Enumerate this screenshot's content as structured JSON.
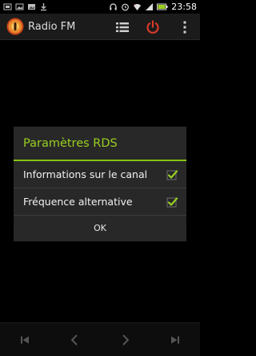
{
  "status_bar": {
    "time": "23:58",
    "left_icons": [
      "usb-icon",
      "image-icon",
      "image-icon",
      "download-icon"
    ],
    "right_icons": [
      "headset-icon",
      "alarm-icon",
      "wifi-icon",
      "signal-icon",
      "battery-icon"
    ]
  },
  "action_bar": {
    "title": "Radio FM",
    "icons": [
      "radio-logo-icon",
      "list-icon",
      "power-icon",
      "overflow-menu-icon"
    ]
  },
  "dialog": {
    "title": "Paramètres RDS",
    "options": [
      {
        "label": "Informations sur le canal",
        "checked": true
      },
      {
        "label": "Fréquence alternative",
        "checked": true
      }
    ],
    "ok_label": "OK"
  },
  "bottom_controls": {
    "icons": [
      "skip-previous-icon",
      "chevron-left-icon",
      "chevron-right-icon",
      "skip-next-icon"
    ]
  },
  "colors": {
    "accent_green": "#9ad022",
    "power_red": "#d83a2a",
    "dialog_bg": "#282828",
    "action_bar_bg": "#1b1b1b"
  }
}
